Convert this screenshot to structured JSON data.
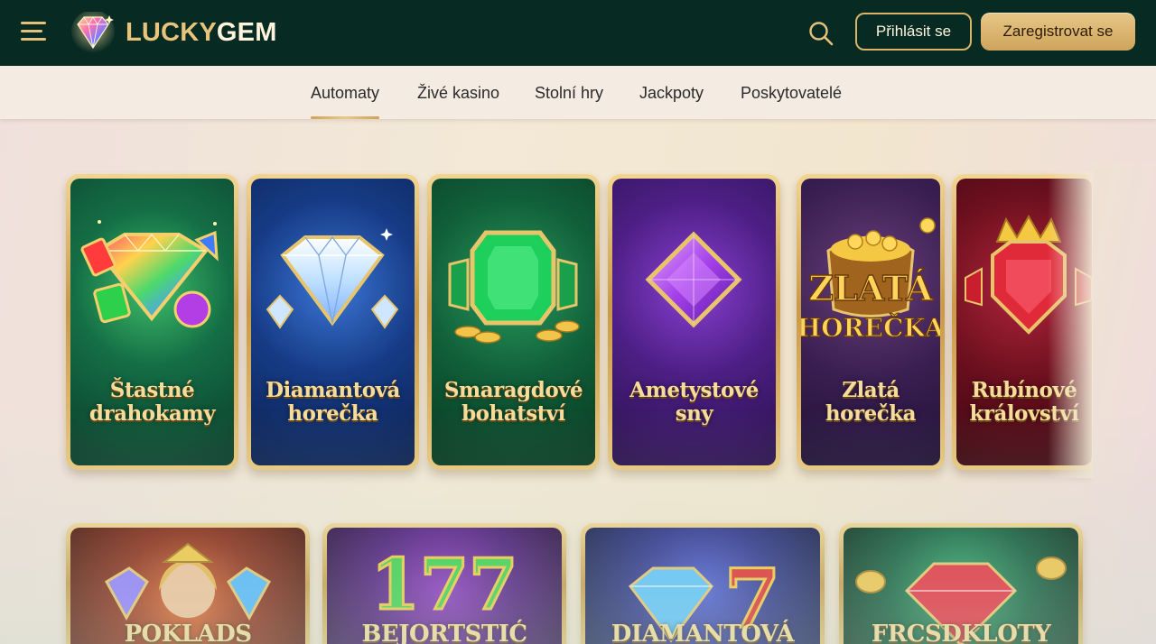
{
  "header": {
    "logo_lucky": "LUCKY",
    "logo_gem": "GEM",
    "login_label": "Přihlásit se",
    "register_label": "Zaregistrovat se"
  },
  "nav": {
    "tabs": [
      {
        "label": "Automaty",
        "active": true
      },
      {
        "label": "Živé kasino",
        "active": false
      },
      {
        "label": "Stolní hry",
        "active": false
      },
      {
        "label": "Jackpoty",
        "active": false
      },
      {
        "label": "Poskytovatelé",
        "active": false
      }
    ]
  },
  "games_row1": [
    {
      "title_line1": "Štastné",
      "title_line2": "drahokamy",
      "theme": "#0e4a34",
      "icon": "rainbow-gems-icon"
    },
    {
      "title_line1": "Diamantová",
      "title_line2": "horečka",
      "theme": "#0f2c66",
      "icon": "diamond-icon"
    },
    {
      "title_line1": "Smaragdové",
      "title_line2": "bohatství",
      "theme": "#0d4e2e",
      "icon": "emerald-icon"
    },
    {
      "title_line1": "Ametystové",
      "title_line2": "sny",
      "theme": "#3d1a6b",
      "icon": "amethyst-icon"
    },
    {
      "title_line1": "Zlatá",
      "title_line2": "horečka",
      "theme": "#2e1a4a",
      "icon": "gold-coins-icon",
      "art_line1": "ZLATÁ",
      "art_line2": "HOREČKA"
    },
    {
      "title_line1": "Rubínové",
      "title_line2": "království",
      "theme": "#5a0d16",
      "icon": "ruby-crown-icon"
    }
  ],
  "games_row2": [
    {
      "title": "POKLADS",
      "theme": "#6a1c10",
      "icon": "queen-gems-icon"
    },
    {
      "title": "BEJORTSTIĆ",
      "theme": "#3a1460",
      "icon": "lucky-777-icon",
      "art_number": "177"
    },
    {
      "title": "DIAMANTOVÁ",
      "theme": "#1d2c6b",
      "icon": "diamond-seven-icon",
      "art_number": "7"
    },
    {
      "title": "FRCSDKLOTY",
      "theme": "#0c4a36",
      "icon": "ruby-coins-icon"
    }
  ]
}
